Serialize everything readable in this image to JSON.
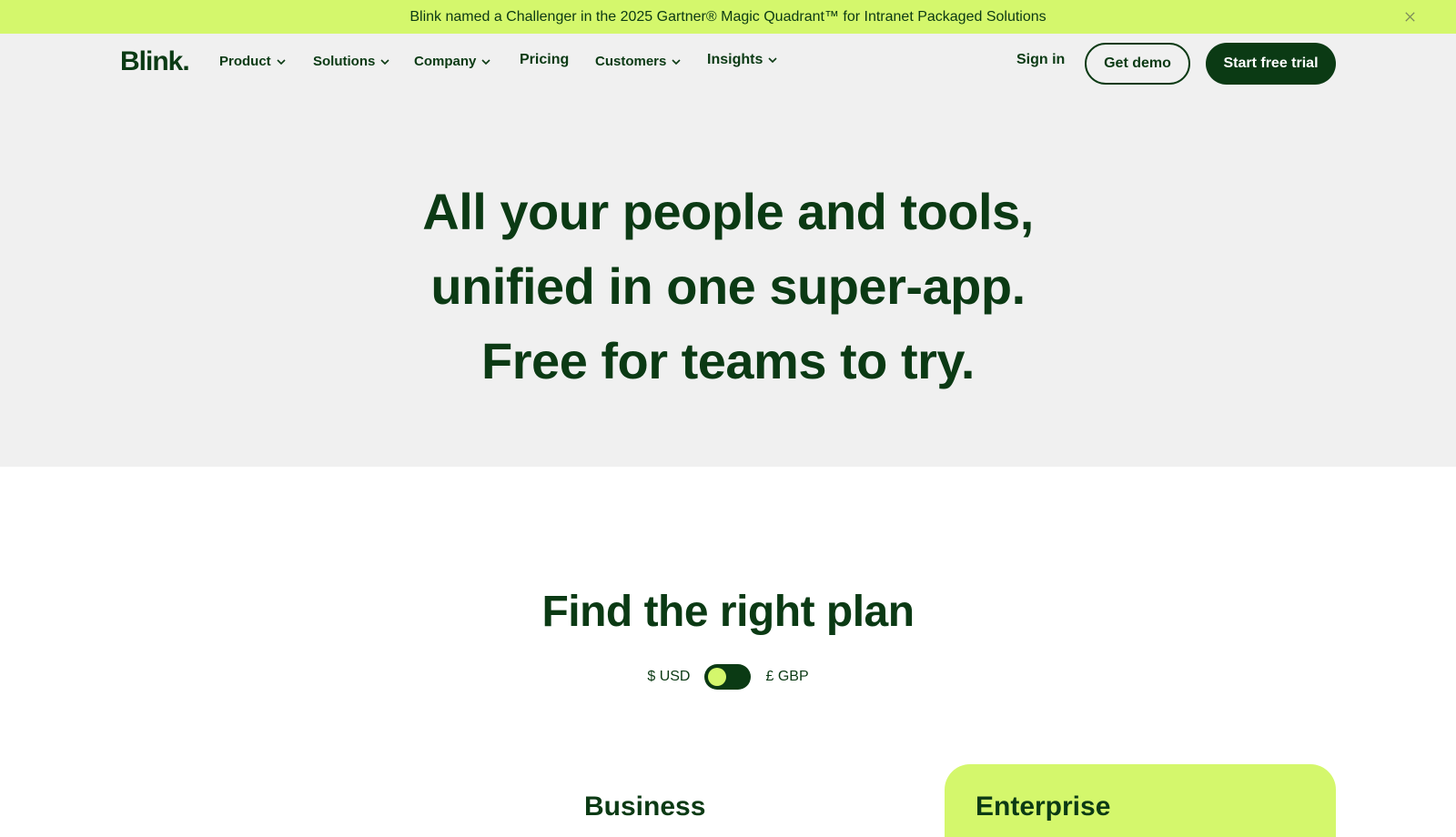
{
  "banner": {
    "text": "Blink named a Challenger in the 2025 Gartner® Magic Quadrant™ for Intranet Packaged Solutions",
    "close_icon": "close-icon"
  },
  "nav": {
    "logo": "Blink.",
    "items": [
      {
        "label": "Product",
        "dropdown": true
      },
      {
        "label": "Solutions",
        "dropdown": true
      },
      {
        "label": "Company",
        "dropdown": true
      },
      {
        "label": "Pricing",
        "dropdown": false
      },
      {
        "label": "Customers",
        "dropdown": true
      },
      {
        "label": "Insights",
        "dropdown": true
      }
    ],
    "sign_in": "Sign in",
    "get_demo": "Get demo",
    "start_trial": "Start free trial"
  },
  "hero": {
    "line1": "All your people and tools,",
    "line2": "unified in one super-app.",
    "line3": "Free for teams to try."
  },
  "plans": {
    "title": "Find the right plan",
    "currency_left": "$ USD",
    "currency_right": "£ GBP",
    "business_label": "Business",
    "enterprise_label": "Enterprise"
  },
  "colors": {
    "accent_lime": "#d4f76c",
    "brand_dark_green": "#0b3a14",
    "hero_bg": "#f0f0f0"
  }
}
